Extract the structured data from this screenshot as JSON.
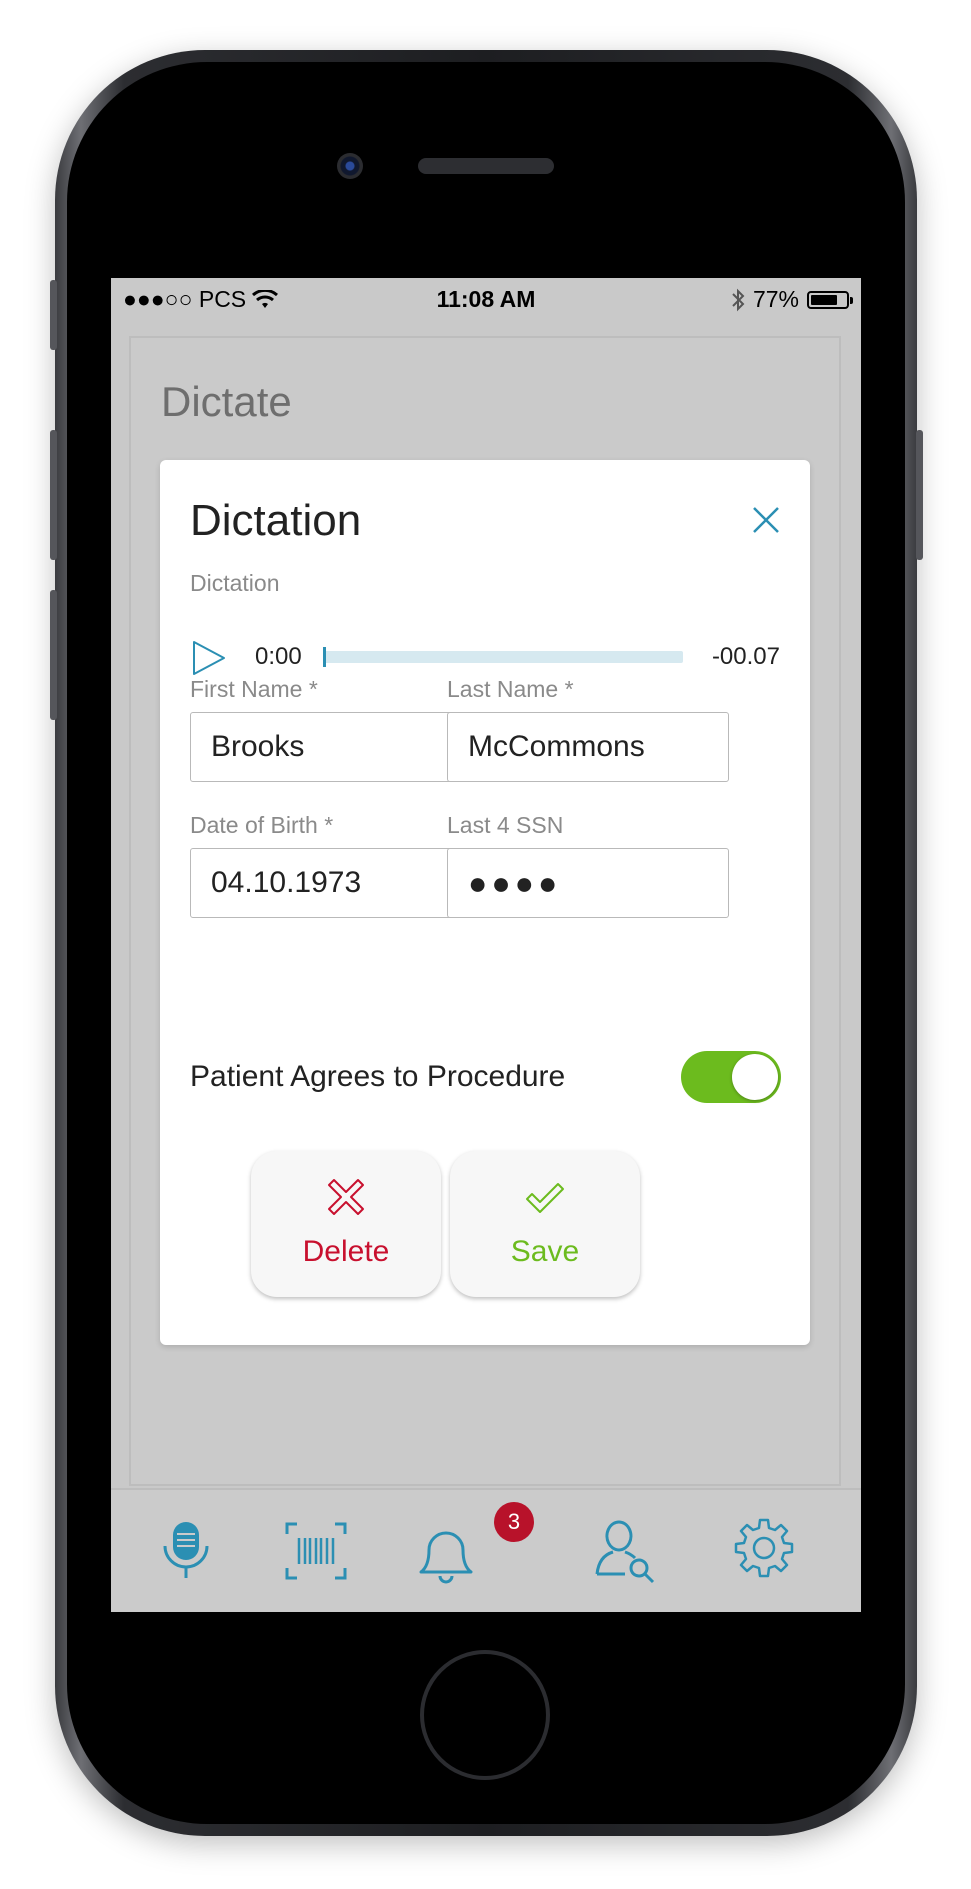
{
  "status_bar": {
    "carrier": "●●●○○ PCS",
    "time": "11:08 AM",
    "battery": "77%",
    "battery_level": 0.77
  },
  "page": {
    "title": "Dictate"
  },
  "dialog": {
    "title": "Dictation",
    "dictation_label": "Dictation",
    "player": {
      "start_time": "0:00",
      "end_time": "-00.07",
      "progress": 0
    },
    "first_name": {
      "label": "First Name *",
      "value": "Brooks"
    },
    "last_name": {
      "label": "Last Name *",
      "value": "McCommons"
    },
    "dob": {
      "label": "Date of Birth *",
      "value": "04.10.1973"
    },
    "ssn": {
      "label": "Last 4 SSN",
      "value": "●●●●"
    },
    "consent": {
      "label": "Patient Agrees to Procedure",
      "enabled": true
    },
    "delete_label": "Delete",
    "save_label": "Save"
  },
  "tab_bar": {
    "items": [
      "microphone-icon",
      "barcode-icon",
      "bell-icon",
      "user-search-icon",
      "gear-icon"
    ],
    "notification_count": "3"
  },
  "colors": {
    "accent": "#2b8fb3",
    "delete": "#c8102e",
    "save": "#6cbb1e",
    "badge": "#b8122a"
  }
}
